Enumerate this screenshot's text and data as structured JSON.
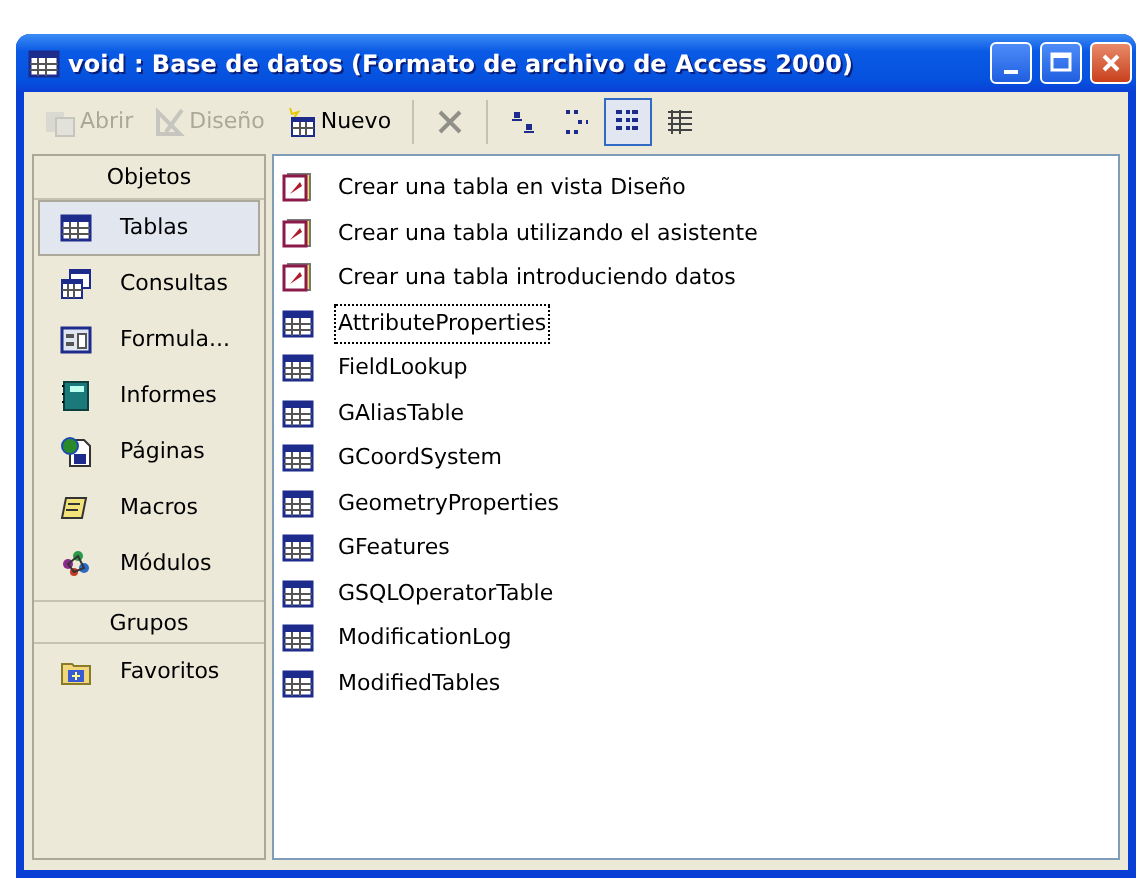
{
  "window": {
    "title": "void : Base de datos (Formato de archivo de Access 2000)"
  },
  "toolbar": [
    {
      "kind": "open",
      "label": "Abrir",
      "disabled": true,
      "selected": false
    },
    {
      "kind": "design",
      "label": "Diseño",
      "disabled": true,
      "selected": false
    },
    {
      "kind": "new",
      "label": "Nuevo",
      "disabled": false,
      "selected": false
    },
    {
      "kind": "separator"
    },
    {
      "kind": "delete",
      "disabled": true,
      "selected": false
    },
    {
      "kind": "separator"
    },
    {
      "kind": "large-icons",
      "disabled": false,
      "selected": false
    },
    {
      "kind": "small-icons",
      "disabled": false,
      "selected": false
    },
    {
      "kind": "list",
      "disabled": false,
      "selected": true
    },
    {
      "kind": "details",
      "disabled": false,
      "selected": false
    }
  ],
  "sidebar": {
    "sections": [
      {
        "header": "Objetos",
        "items": [
          {
            "kind": "table",
            "label": "Tablas",
            "selected": true
          },
          {
            "kind": "query",
            "label": "Consultas",
            "selected": false
          },
          {
            "kind": "form",
            "label": "Formula...",
            "selected": false
          },
          {
            "kind": "report",
            "label": "Informes",
            "selected": false
          },
          {
            "kind": "page",
            "label": "Páginas",
            "selected": false
          },
          {
            "kind": "macro",
            "label": "Macros",
            "selected": false
          },
          {
            "kind": "module",
            "label": "Módulos",
            "selected": false
          }
        ]
      },
      {
        "header": "Grupos",
        "items": [
          {
            "kind": "folder",
            "label": "Favoritos",
            "selected": false
          }
        ]
      }
    ]
  },
  "objects": [
    {
      "kind": "wizard",
      "label": "Crear una tabla en vista Diseño",
      "focused": false
    },
    {
      "kind": "wizard",
      "label": "Crear una tabla utilizando el asistente",
      "focused": false
    },
    {
      "kind": "wizard",
      "label": "Crear una tabla introduciendo datos",
      "focused": false
    },
    {
      "kind": "table",
      "label": "AttributeProperties",
      "focused": true
    },
    {
      "kind": "table",
      "label": "FieldLookup",
      "focused": false
    },
    {
      "kind": "table",
      "label": "GAliasTable",
      "focused": false
    },
    {
      "kind": "table",
      "label": "GCoordSystem",
      "focused": false
    },
    {
      "kind": "table",
      "label": "GeometryProperties",
      "focused": false
    },
    {
      "kind": "table",
      "label": "GFeatures",
      "focused": false
    },
    {
      "kind": "table",
      "label": "GSQLOperatorTable",
      "focused": false
    },
    {
      "kind": "table",
      "label": "ModificationLog",
      "focused": false
    },
    {
      "kind": "table",
      "label": "ModifiedTables",
      "focused": false
    }
  ]
}
